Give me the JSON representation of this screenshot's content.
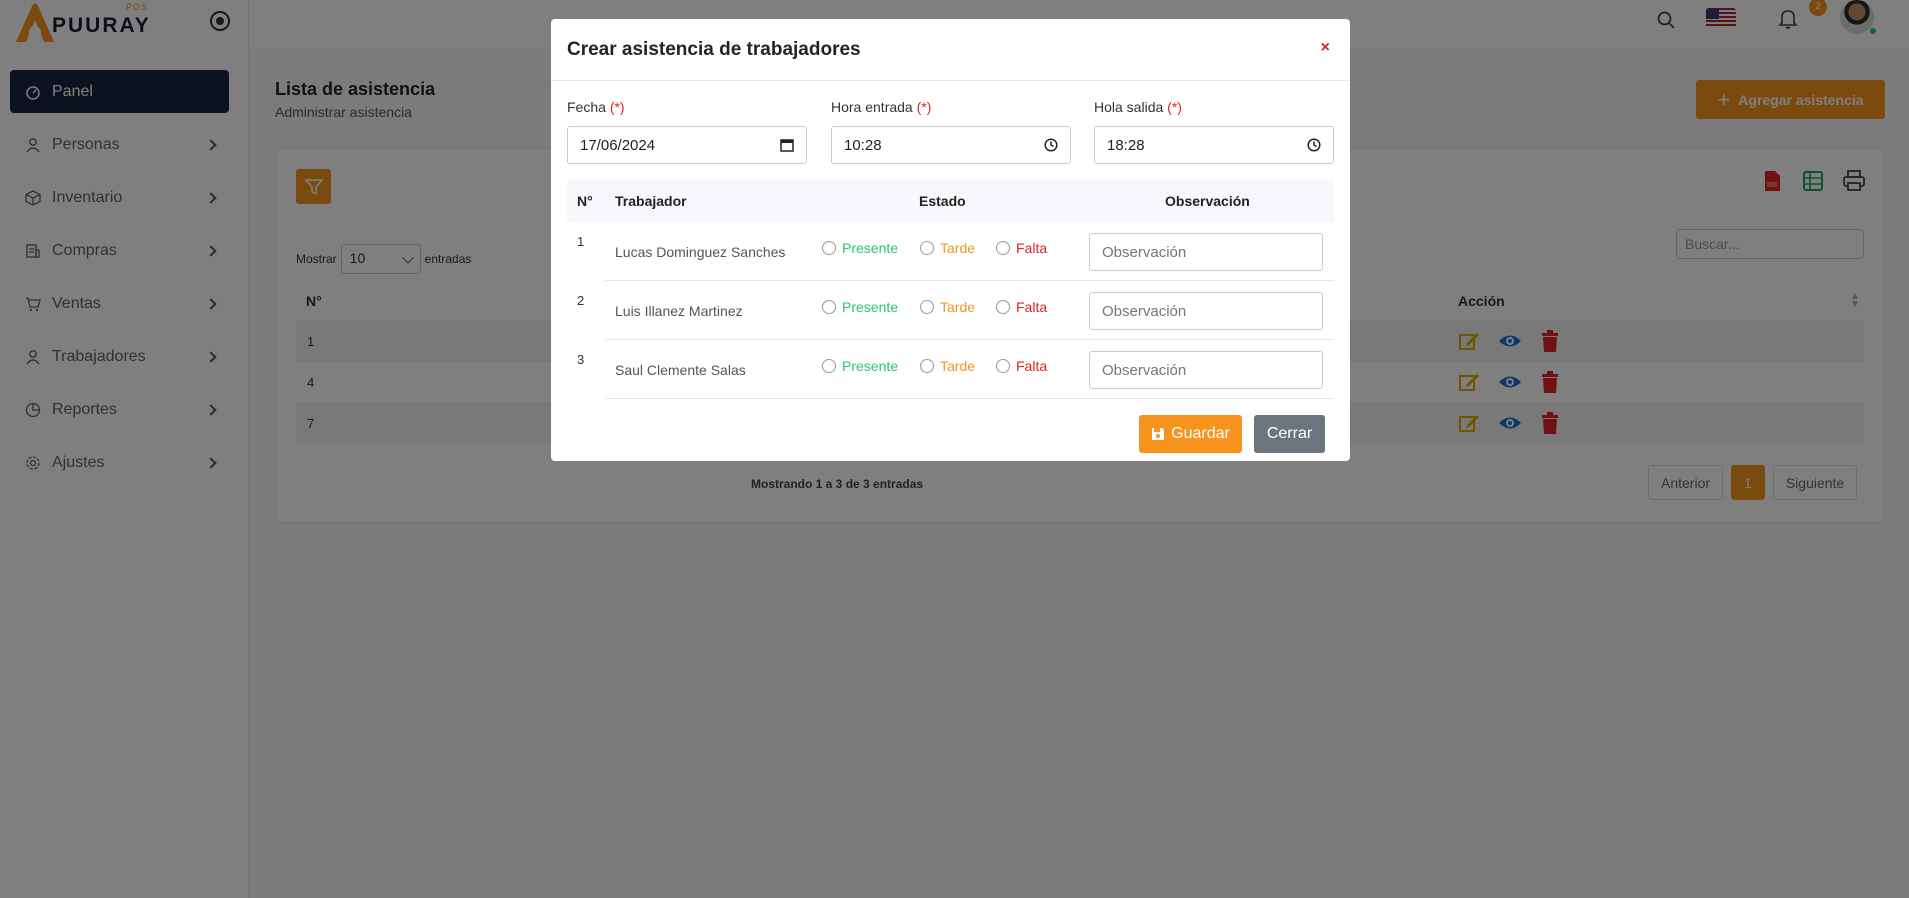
{
  "brand": {
    "name": "PUURAY",
    "suffix": "POS"
  },
  "sidebar": {
    "items": [
      {
        "label": "Panel",
        "icon": "gauge-icon",
        "active": true
      },
      {
        "label": "Personas",
        "icon": "user-icon"
      },
      {
        "label": "Inventario",
        "icon": "box-icon"
      },
      {
        "label": "Compras",
        "icon": "receipt-icon"
      },
      {
        "label": "Ventas",
        "icon": "cart-icon"
      },
      {
        "label": "Trabajadores",
        "icon": "user-icon"
      },
      {
        "label": "Reportes",
        "icon": "pie-chart-icon"
      },
      {
        "label": "Ajustes",
        "icon": "gear-icon"
      }
    ]
  },
  "topbar": {
    "notification_count": "2"
  },
  "page": {
    "title": "Lista de asistencia",
    "subtitle": "Administrar asistencia",
    "add_button": "Agregar asistencia"
  },
  "list": {
    "show_label": "Mostrar",
    "show_value": "10",
    "entries_label": "entradas",
    "search_placeholder": "Buscar...",
    "headers": {
      "num": "N°",
      "action": "Acción"
    },
    "rows": [
      {
        "num": "1"
      },
      {
        "num": "4"
      },
      {
        "num": "7"
      }
    ],
    "info": "Mostrando 1 a 3 de 3 entradas",
    "pagination": {
      "prev": "Anterior",
      "current": "1",
      "next": "Siguiente"
    }
  },
  "modal": {
    "title": "Crear asistencia de trabajadores",
    "close_glyph": "×",
    "fields": {
      "fecha": {
        "label": "Fecha",
        "req": "(*)",
        "value": "17/06/2024"
      },
      "entrada": {
        "label": "Hora entrada",
        "req": "(*)",
        "value": "10:28"
      },
      "salida": {
        "label": "Hola salida",
        "req": "(*)",
        "value": "18:28"
      }
    },
    "table": {
      "headers": {
        "num": "N°",
        "worker": "Trabajador",
        "status": "Estado",
        "obs": "Observación"
      },
      "status_options": {
        "present": "Presente",
        "late": "Tarde",
        "absent": "Falta"
      },
      "obs_placeholder": "Observación",
      "rows": [
        {
          "num": "1",
          "name": "Lucas Dominguez Sanches"
        },
        {
          "num": "2",
          "name": "Luis Illanez Martinez"
        },
        {
          "num": "3",
          "name": "Saul Clemente Salas"
        }
      ]
    },
    "save_button": "Guardar",
    "close_button": "Cerrar"
  },
  "colors": {
    "accent": "#f7941d",
    "sidebar_active": "#1b2540",
    "present": "#28c76f",
    "absent": "#e02424"
  }
}
